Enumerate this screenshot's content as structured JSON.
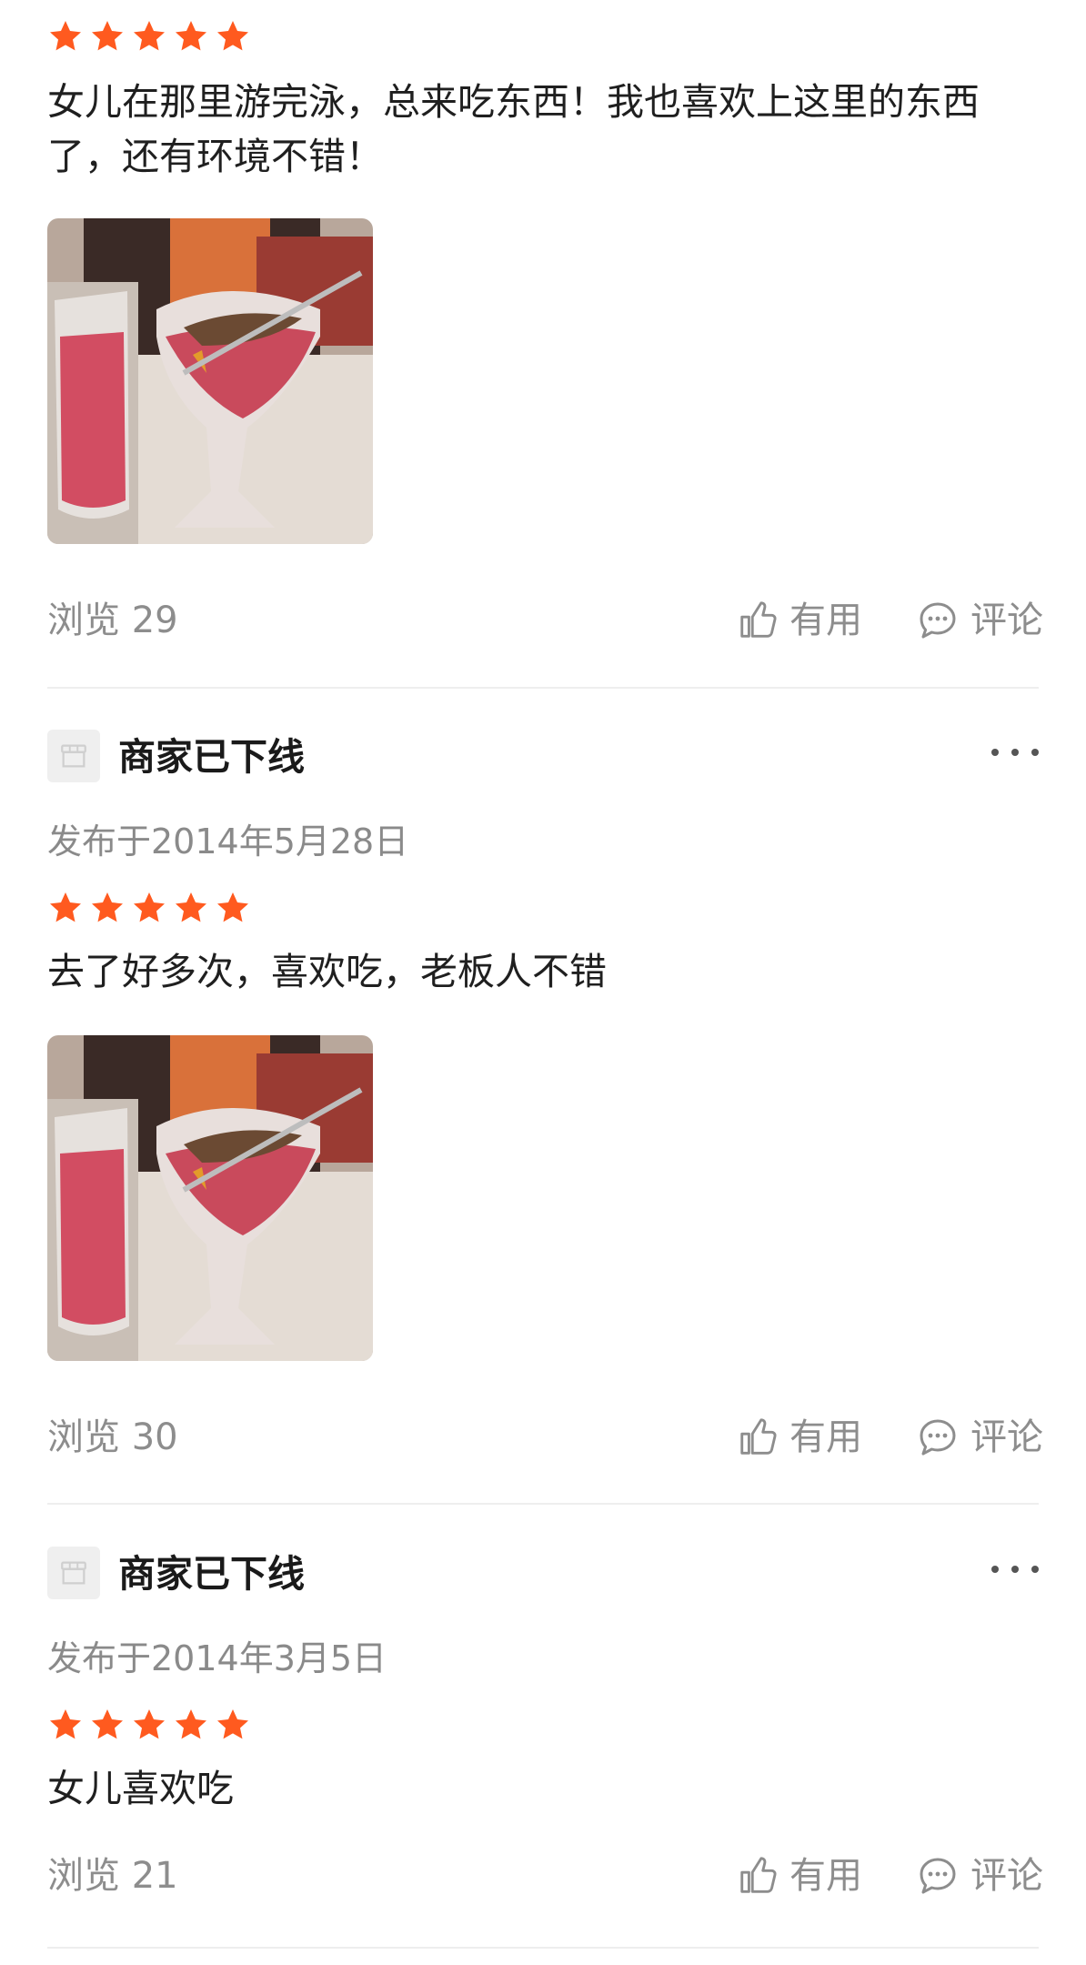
{
  "reviews": [
    {
      "text": "女儿在那里游完泳，总来吃东西！我也喜欢上这里的东西了，还有环境不错！",
      "rating": 5,
      "photo": "drinks-photo",
      "views_label": "浏览",
      "views": "29"
    },
    {
      "merchant": "商家已下线",
      "date": "发布于2014年5月28日",
      "rating": 5,
      "text": "去了好多次，喜欢吃，老板人不错",
      "photo": "drinks-photo",
      "views_label": "浏览",
      "views": "30"
    },
    {
      "merchant": "商家已下线",
      "date": "发布于2014年3月5日",
      "rating": 5,
      "text": "女儿喜欢吃",
      "views_label": "浏览",
      "views": "21"
    }
  ],
  "actions": {
    "useful": "有用",
    "comment": "评论"
  },
  "icons": {
    "star": "star-icon",
    "like": "thumbs-up-icon",
    "comment": "comment-bubble-icon",
    "more": "more-dots-icon",
    "shop": "shop-icon"
  },
  "colors": {
    "star": "#ff5a1f",
    "muted_text": "#8d8d8d",
    "divider": "#eeeeee"
  }
}
